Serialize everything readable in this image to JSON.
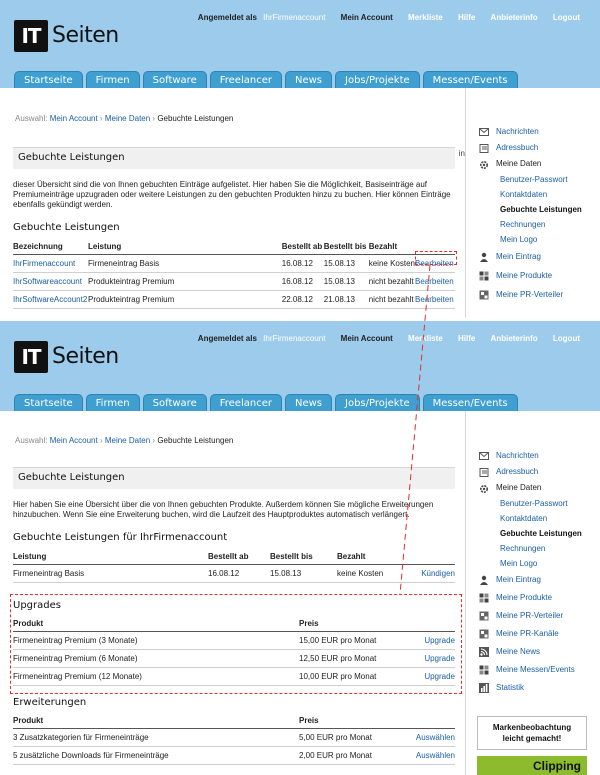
{
  "logo": {
    "it": "IT",
    "seiten": "Seiten"
  },
  "topnav": {
    "logged_in_label": "Angemeldet als",
    "account_name": "IhrFirmenaccount",
    "items": [
      "Mein Account",
      "Merkliste",
      "Hilfe",
      "Anbieterinfo",
      "Logout"
    ]
  },
  "tabs": [
    "Startseite",
    "Firmen",
    "Software",
    "Freelancer",
    "News",
    "Jobs/Projekte",
    "Messen/Events"
  ],
  "screen1": {
    "breadcrumb": {
      "prefix": "Auswahl:",
      "items": [
        "Mein Account",
        "Meine Daten"
      ],
      "current": "Gebuchte Leistungen"
    },
    "title": "Gebuchte Leistungen",
    "title_suffix": "in",
    "intro": "dieser Übersicht sind die von Ihnen gebuchten Einträge aufgelistet. Hier haben Sie die Möglichkeit, Basiseinträge auf Premiumeinträge upzugraden oder weitere Leistungen zu den gebuchten Produkten hinzu zu buchen. Hier können Einträge ebenfalls gekündigt werden.",
    "section_title": "Gebuchte Leistungen",
    "table": {
      "headers": [
        "Bezeichnung",
        "Leistung",
        "Bestellt ab",
        "Bestellt bis",
        "Bezahlt",
        ""
      ],
      "rows": [
        [
          "IhrFirmenaccount",
          "Firmeneintrag Basis",
          "16.08.12",
          "15.08.13",
          "keine Kosten",
          "Bearbeiten"
        ],
        [
          "IhrSoftwareaccount",
          "Produkteintrag Premium",
          "16.08.12",
          "15.08.13",
          "nicht bezahlt",
          "Bearbeiten"
        ],
        [
          "IhrSoftwareAccount2",
          "Produkteintrag Premium",
          "22.08.12",
          "21.08.13",
          "nicht bezahlt",
          "Bearbeiten"
        ]
      ]
    },
    "sidebar": {
      "items": [
        {
          "label": "Nachrichten",
          "icon": "envelope-icon"
        },
        {
          "label": "Adressbuch",
          "icon": "address-book-icon"
        },
        {
          "label": "Meine Daten",
          "icon": "gear-icon"
        }
      ],
      "sub_items": [
        "Benutzer-Passwort",
        "Kontaktdaten",
        "Gebuchte Leistungen",
        "Rechnungen",
        "Mein Logo"
      ],
      "items_after": [
        {
          "label": "Mein Eintrag",
          "icon": "person-icon"
        },
        {
          "label": "Meine Produkte",
          "icon": "grid-icon"
        },
        {
          "label": "Meine PR-Verteiler",
          "icon": "list-icon"
        }
      ]
    }
  },
  "screen2": {
    "breadcrumb": {
      "prefix": "Auswahl:",
      "items": [
        "Mein Account",
        "Meine Daten"
      ],
      "current": "Gebuchte Leistungen"
    },
    "title": "Gebuchte Leistungen",
    "intro": "Hier haben Sie eine Übersicht über die von Ihnen gebuchten Produkte. Außerdem können Sie mögliche Erweiterungen hinzubuchen. Wenn Sie eine Erweiterung buchen, wird die Laufzeit des Hauptproduktes automatisch verlängert.",
    "section_title": "Gebuchte Leistungen für IhrFirmenaccount",
    "booked": {
      "headers": [
        "Leistung",
        "Bestellt ab",
        "Bestellt bis",
        "Bezahlt",
        ""
      ],
      "rows": [
        [
          "Firmeneintrag Basis",
          "16.08.12",
          "15.08.13",
          "keine Kosten",
          "Kündigen"
        ]
      ]
    },
    "upgrades": {
      "title": "Upgrades",
      "headers": [
        "Produkt",
        "Preis",
        ""
      ],
      "rows": [
        [
          "Firmeneintrag Premium (3 Monate)",
          "15,00 EUR pro Monat",
          "Upgrade"
        ],
        [
          "Firmeneintrag Premium (6 Monate)",
          "12,50 EUR pro Monat",
          "Upgrade"
        ],
        [
          "Firmeneintrag Premium (12 Monate)",
          "10,00 EUR pro Monat",
          "Upgrade"
        ]
      ]
    },
    "erweiterungen": {
      "title": "Erweiterungen",
      "headers": [
        "Produkt",
        "Preis",
        ""
      ],
      "rows": [
        [
          "3 Zusatzkategorien für Firmeneinträge",
          "5,00 EUR pro Monat",
          "Auswählen"
        ],
        [
          "5 zusätzliche Downloads für Firmeneinträge",
          "2,00 EUR pro Monat",
          "Auswählen"
        ]
      ]
    },
    "sidebar": {
      "items": [
        {
          "label": "Nachrichten",
          "icon": "envelope-icon"
        },
        {
          "label": "Adressbuch",
          "icon": "address-book-icon"
        },
        {
          "label": "Meine Daten",
          "icon": "gear-icon"
        }
      ],
      "sub_items": [
        "Benutzer-Passwort",
        "Kontaktdaten",
        "Gebuchte Leistungen",
        "Rechnungen",
        "Mein Logo"
      ],
      "items_after": [
        {
          "label": "Mein Eintrag",
          "icon": "person-icon"
        },
        {
          "label": "Meine Produkte",
          "icon": "grid-icon"
        },
        {
          "label": "Meine PR-Verteiler",
          "icon": "list-icon"
        },
        {
          "label": "Meine PR-Kanäle",
          "icon": "list-icon"
        },
        {
          "label": "Meine News",
          "icon": "rss-icon"
        },
        {
          "label": "Meine Messen/Events",
          "icon": "grid-icon"
        },
        {
          "label": "Statistik",
          "icon": "chart-icon"
        }
      ],
      "banner_lines": [
        "Markenbeobachtung",
        "leicht gemacht!"
      ],
      "banner2_text": "Clipping"
    }
  },
  "colors": {
    "header": "#9ccbeb",
    "tab": "#3f9fd0",
    "link": "#1a5fa5",
    "highlight": "#e03030"
  }
}
